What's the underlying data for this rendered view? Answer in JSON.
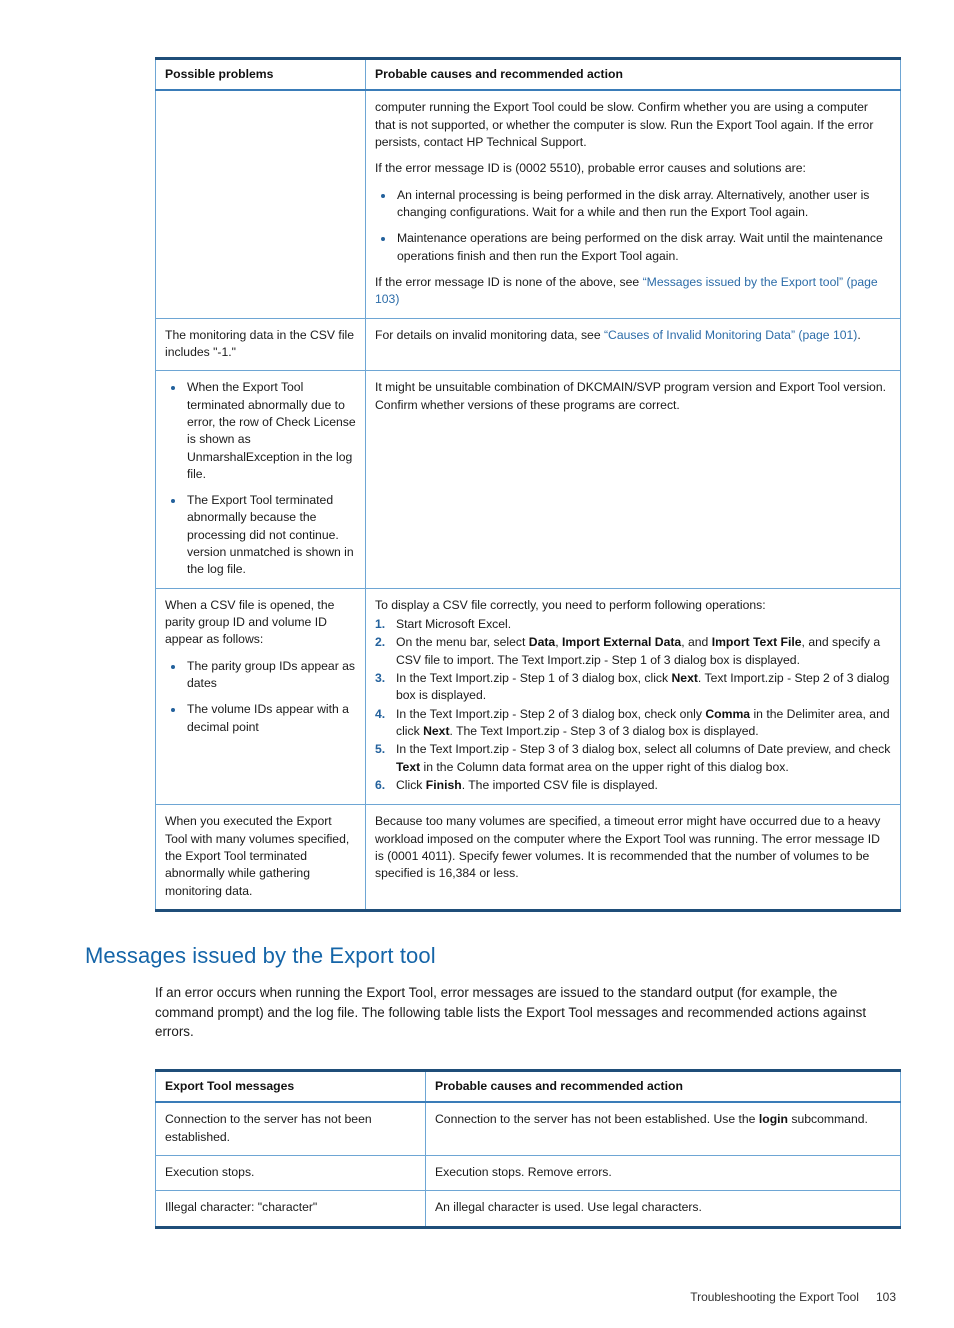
{
  "document": {
    "footer": {
      "chapter": "Troubleshooting the Export Tool",
      "page_number": "103"
    },
    "colors": {
      "heading_blue": "#1565a8",
      "link_blue": "#2c6ca8",
      "table_border_dark": "#1f4e79",
      "table_border_light": "#6ea6d4",
      "bullet_blue": "#23619c"
    }
  },
  "table_problems": {
    "headers": {
      "col1": "Possible problems",
      "col2": "Probable causes and recommended action"
    },
    "rows": [
      {
        "problem": "",
        "cause": {
          "para1": "computer running the Export Tool could be slow. Confirm whether you are using a computer that is not supported, or whether the computer is slow. Run the Export Tool again. If the error persists, contact HP Technical Support.",
          "para2": "If the error message ID is (0002 5510), probable error causes and solutions are:",
          "bullets": [
            "An internal processing is being performed in the disk array. Alternatively, another user is changing configurations. Wait for a while and then run the Export Tool again.",
            "Maintenance operations are being performed on the disk array. Wait until the maintenance operations finish and then run the Export Tool again."
          ],
          "para3_pre": "If the error message ID is none of the above, see ",
          "para3_link": "“Messages issued by the Export tool” (page 103)"
        }
      },
      {
        "problem": "The monitoring data in the CSV file includes \"-1.\"",
        "cause": {
          "para1_pre": "For details on invalid monitoring data, see ",
          "para1_link": "“Causes of Invalid Monitoring Data” (page 101)",
          "para1_post": "."
        }
      },
      {
        "problem_bullets": [
          "When the Export Tool terminated abnormally due to error, the row of Check License is shown as UnmarshalException in the log file.",
          "The Export Tool terminated abnormally because the processing did not continue. version unmatched is shown in the log file."
        ],
        "cause": {
          "para1": "It might be unsuitable combination of DKCMAIN/SVP program version and Export Tool version. Confirm whether versions of these programs are correct."
        }
      },
      {
        "problem_intro": "When a CSV file is opened, the parity group ID and volume ID appear as follows:",
        "problem_bullets": [
          "The parity group IDs appear as dates",
          "The volume IDs appear with a decimal point"
        ],
        "cause": {
          "intro": "To display a CSV file correctly, you need to perform following operations:",
          "steps": [
            {
              "parts": [
                {
                  "t": "Start Microsoft Excel.",
                  "b": false
                }
              ]
            },
            {
              "parts": [
                {
                  "t": "On the menu bar, select ",
                  "b": false
                },
                {
                  "t": "Data",
                  "b": true
                },
                {
                  "t": ", ",
                  "b": false
                },
                {
                  "t": "Import External Data",
                  "b": true
                },
                {
                  "t": ", and ",
                  "b": false
                },
                {
                  "t": "Import Text File",
                  "b": true
                },
                {
                  "t": ", and specify a CSV file to import. The Text Import.zip - Step 1 of 3 dialog box is displayed.",
                  "b": false
                }
              ]
            },
            {
              "parts": [
                {
                  "t": "In the Text Import.zip - Step 1 of 3 dialog box, click ",
                  "b": false
                },
                {
                  "t": "Next",
                  "b": true
                },
                {
                  "t": ". Text Import.zip - Step 2 of 3 dialog box is displayed.",
                  "b": false
                }
              ]
            },
            {
              "parts": [
                {
                  "t": "In the Text Import.zip - Step 2 of 3 dialog box, check only ",
                  "b": false
                },
                {
                  "t": "Comma",
                  "b": true
                },
                {
                  "t": " in the Delimiter area, and click ",
                  "b": false
                },
                {
                  "t": "Next",
                  "b": true
                },
                {
                  "t": ". The Text Import.zip - Step 3 of 3 dialog box is displayed.",
                  "b": false
                }
              ]
            },
            {
              "parts": [
                {
                  "t": "In the Text Import.zip - Step 3 of 3 dialog box, select all columns of Date preview, and check ",
                  "b": false
                },
                {
                  "t": "Text",
                  "b": true
                },
                {
                  "t": " in the Column data format area on the upper right of this dialog box.",
                  "b": false
                }
              ]
            },
            {
              "parts": [
                {
                  "t": "Click ",
                  "b": false
                },
                {
                  "t": "Finish",
                  "b": true
                },
                {
                  "t": ". The imported CSV file is displayed.",
                  "b": false
                }
              ]
            }
          ]
        }
      },
      {
        "problem": "When you executed the Export Tool with many volumes specified, the Export Tool terminated abnormally while gathering monitoring data.",
        "cause": {
          "para1": "Because too many volumes are specified, a timeout error might have occurred due to a heavy workload imposed on the computer where the Export Tool was running. The error message ID is (0001 4011). Specify fewer volumes. It is recommended that the number of volumes to be specified is 16,384 or less."
        }
      }
    ]
  },
  "section": {
    "heading": "Messages issued by the Export tool",
    "body": "If an error occurs when running the Export Tool, error messages are issued to the standard output (for example, the command prompt) and the log file. The following table lists the Export Tool messages and recommended actions against errors."
  },
  "table_messages": {
    "headers": {
      "col1": "Export Tool messages",
      "col2": "Probable causes and recommended action"
    },
    "rows": [
      {
        "message": "Connection to the server has not been established.",
        "action_parts": [
          {
            "t": "Connection to the server has not been established. Use the ",
            "b": false
          },
          {
            "t": "login",
            "b": true
          },
          {
            "t": " subcommand.",
            "b": false
          }
        ]
      },
      {
        "message": "Execution stops.",
        "action_parts": [
          {
            "t": "Execution stops. Remove errors.",
            "b": false
          }
        ]
      },
      {
        "message": "Illegal character: \"character\"",
        "action_parts": [
          {
            "t": "An illegal character is used. Use legal characters.",
            "b": false
          }
        ]
      }
    ]
  }
}
